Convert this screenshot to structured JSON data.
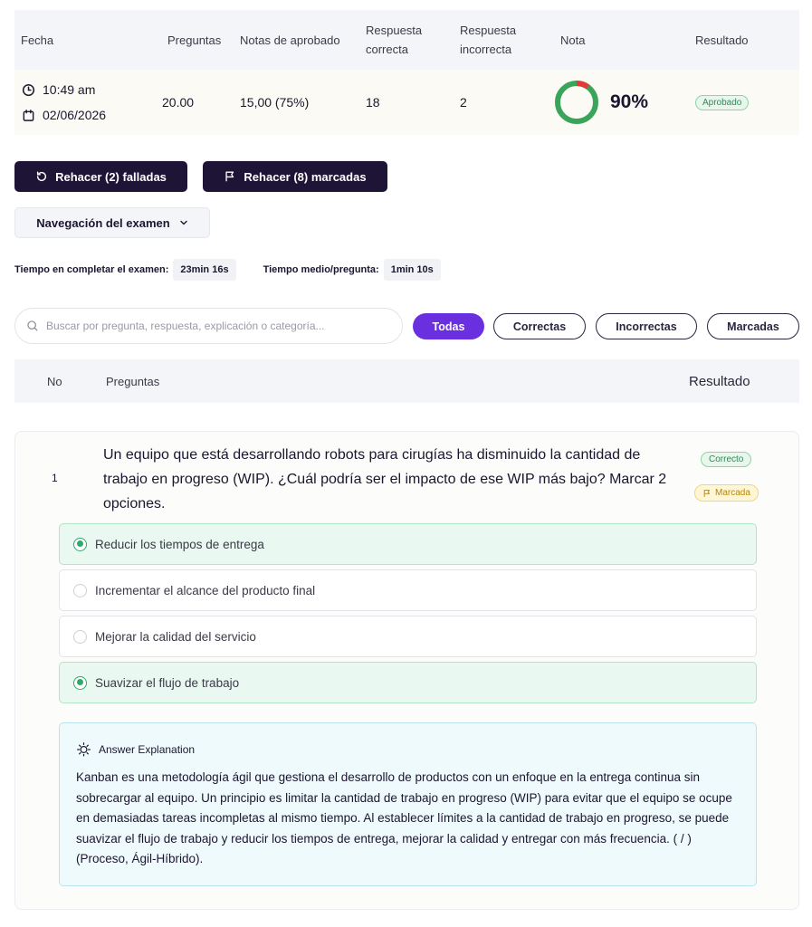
{
  "summary": {
    "headers": {
      "fecha": "Fecha",
      "preguntas": "Preguntas",
      "notas": "Notas de aprobado",
      "correcta_1": "Respuesta",
      "correcta_2": "correcta",
      "incorrecta_1": "Respuesta",
      "incorrecta_2": "incorrecta",
      "nota": "Nota",
      "resultado": "Resultado"
    },
    "row": {
      "time": "10:49 am",
      "date": "02/06/2026",
      "preguntas": "20.00",
      "notas": "15,00 (75%)",
      "correctas": "18",
      "incorrectas": "2",
      "grade_percent": 90,
      "grade_label": "90%",
      "resultado": "Aprobado"
    },
    "colors": {
      "ring_ok": "#3aa55a",
      "ring_bad": "#e03a3a"
    }
  },
  "actions": {
    "retry_failed": "Rehacer (2) falladas",
    "retry_marked": "Rehacer (8) marcadas",
    "nav": "Navegación del examen"
  },
  "times": {
    "total_label": "Tiempo en completar el examen:",
    "total_value": "23min 16s",
    "avg_label": "Tiempo medio/pregunta:",
    "avg_value": "1min 10s"
  },
  "search": {
    "placeholder": "Buscar por pregunta, respuesta, explicación o categoría..."
  },
  "filters": {
    "all": "Todas",
    "correct": "Correctas",
    "incorrect": "Incorrectas",
    "marked": "Marcadas"
  },
  "question_table": {
    "no": "No",
    "questions": "Preguntas",
    "result": "Resultado"
  },
  "question": {
    "number": "1",
    "text": "Un equipo que está desarrollando robots para cirugías ha disminuido la cantidad de trabajo en progreso (WIP). ¿Cuál podría ser el impacto de ese WIP más bajo? Marcar 2 opciones.",
    "status": "Correcto",
    "flag": "Marcada",
    "options": [
      {
        "label": "Reducir los tiempos de entrega",
        "correct": true
      },
      {
        "label": "Incrementar el alcance del producto final",
        "correct": false
      },
      {
        "label": "Mejorar la calidad del servicio",
        "correct": false
      },
      {
        "label": "Suavizar el flujo de trabajo",
        "correct": true
      }
    ],
    "explanation_title": "Answer Explanation",
    "explanation": "Kanban es una metodología ágil que gestiona el desarrollo de productos con un enfoque en la entrega continua sin sobrecargar al equipo. Un principio es limitar la cantidad de trabajo en progreso (WIP) para evitar que el equipo se ocupe en demasiadas tareas incompletas al mismo tiempo. Al establecer límites a la cantidad de trabajo en progreso, se puede suavizar el flujo de trabajo y reducir los tiempos de entrega, mejorar la calidad y entregar con más frecuencia. ( / ) (Proceso, Ágil-Híbrido)."
  }
}
